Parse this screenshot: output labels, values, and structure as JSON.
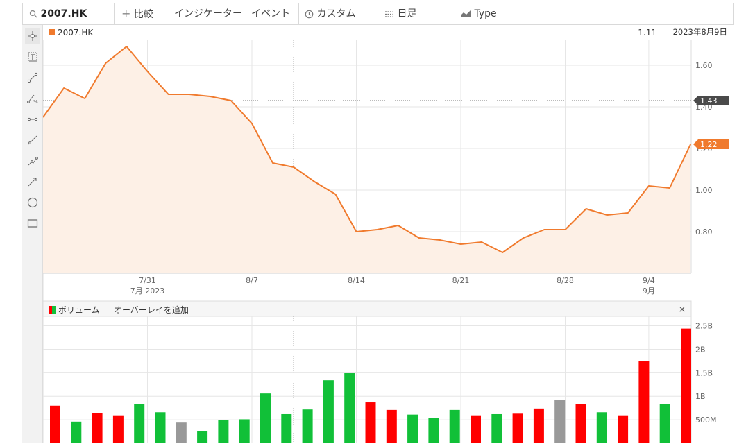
{
  "toolbar": {
    "symbol": "2007.HK",
    "compare": "比較",
    "indicators": "インジケーター",
    "events": "イベント",
    "custom": "カスタム",
    "period": "日足",
    "type": "Type"
  },
  "price_panel": {
    "legend": "2007.HK",
    "info_value": "1.11",
    "info_date": "2023年8月9日",
    "last_marker": "1.22",
    "crosshair_marker": "1.43"
  },
  "volume_panel": {
    "legend": "ボリューム",
    "overlay": "オーバーレイを追加",
    "close": "×"
  },
  "colors": {
    "price_line": "#f07a2d",
    "price_fill": "#fdf0e6",
    "crosshair_label": "#4a4a4a",
    "volume_up": "#11c038",
    "volume_down": "#ff0000",
    "volume_flat": "#999999"
  },
  "chart_data": [
    {
      "type": "area",
      "title": "2007.HK",
      "x_ticks": [
        {
          "label": "7/31",
          "sub": "7月 2023",
          "index": 5
        },
        {
          "label": "8/7",
          "sub": "",
          "index": 10
        },
        {
          "label": "8/14",
          "sub": "",
          "index": 15
        },
        {
          "label": "8/21",
          "sub": "",
          "index": 20
        },
        {
          "label": "8/28",
          "sub": "",
          "index": 25
        },
        {
          "label": "9/4",
          "sub": "9月",
          "index": 29
        }
      ],
      "y_ticks": [
        "0.80",
        "1.00",
        "1.20",
        "1.40",
        "1.60"
      ],
      "ylim": [
        0.6,
        1.72
      ],
      "series": [
        {
          "values": [
            1.35,
            1.49,
            1.44,
            1.61,
            1.69,
            1.57,
            1.46,
            1.46,
            1.45,
            1.43,
            1.32,
            1.13,
            1.11,
            1.04,
            0.98,
            0.8,
            0.81,
            0.83,
            0.77,
            0.76,
            0.74,
            0.75,
            0.7,
            0.77,
            0.81,
            0.81,
            0.91,
            0.88,
            0.89,
            1.02,
            1.01,
            1.22
          ]
        }
      ],
      "crosshair_index": 12,
      "crosshair_value": 1.43
    },
    {
      "type": "bar",
      "title": "ボリューム",
      "y_ticks": [
        "500M",
        "1B",
        "1.5B",
        "2B",
        "2.5B"
      ],
      "ylim_millions": [
        0,
        2700
      ],
      "values_millions": [
        800,
        460,
        640,
        580,
        840,
        660,
        440,
        260,
        490,
        510,
        1060,
        620,
        720,
        1340,
        1490,
        870,
        710,
        610,
        540,
        710,
        580,
        620,
        630,
        740,
        920,
        840,
        660,
        580,
        1750,
        840,
        2440
      ],
      "directions": [
        "down",
        "up",
        "down",
        "down",
        "up",
        "up",
        "flat",
        "up",
        "up",
        "up",
        "up",
        "up",
        "up",
        "up",
        "up",
        "down",
        "down",
        "up",
        "up",
        "up",
        "down",
        "up",
        "down",
        "down",
        "flat",
        "down",
        "up",
        "down",
        "down",
        "up",
        "down"
      ]
    }
  ]
}
